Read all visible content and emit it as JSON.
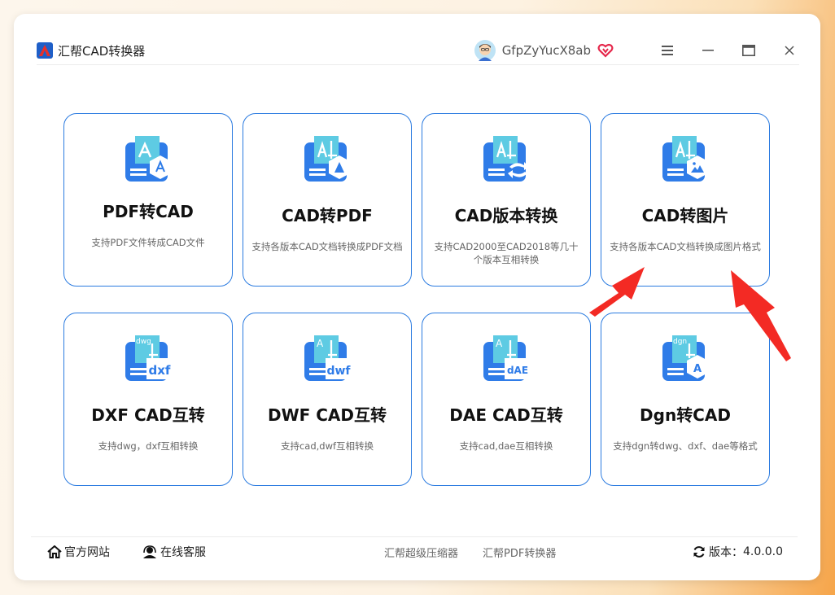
{
  "app": {
    "title": "汇帮CAD转换器"
  },
  "user": {
    "name": "GfpZyYucX8ab"
  },
  "icons": {
    "logo": "app-logo-icon",
    "avatar": "user-avatar-icon",
    "vip": "vip-heart-icon",
    "menu": "menu-icon",
    "minimize": "minimize-icon",
    "maximize": "maximize-icon",
    "close": "close-icon",
    "home": "home-icon",
    "support": "headset-icon",
    "refresh": "refresh-icon"
  },
  "colors": {
    "accent": "#2b7be0",
    "icon_blue": "#2f7ce8",
    "icon_light": "#5ecbe3",
    "arrow": "#f32a24"
  },
  "cards": [
    {
      "title": "PDF转CAD",
      "desc": "支持PDF文件转成CAD文件"
    },
    {
      "title": "CAD转PDF",
      "desc": "支持各版本CAD文档转换成PDF文档"
    },
    {
      "title": "CAD版本转换",
      "desc": "支持CAD2000至CAD2018等几十个版本互相转换"
    },
    {
      "title": "CAD转图片",
      "desc": "支持各版本CAD文档转换成图片格式"
    },
    {
      "title": "DXF CAD互转",
      "desc": "支持dwg，dxf互相转换",
      "badge": "dxf",
      "tag": "dwg"
    },
    {
      "title": "DWF CAD互转",
      "desc": "支持cad,dwf互相转换",
      "badge": "dwf",
      "tag": "A"
    },
    {
      "title": "DAE CAD互转",
      "desc": "支持cad,dae互相转换",
      "badge": "dAE",
      "tag": "A"
    },
    {
      "title": "Dgn转CAD",
      "desc": "支持dgn转dwg、dxf、dae等格式",
      "badge": "A",
      "tag": "dgn"
    }
  ],
  "footer": {
    "website": "官方网站",
    "support": "在线客服",
    "link1": "汇帮超级压缩器",
    "link2": "汇帮PDF转换器",
    "version_label": "版本：",
    "version": "4.0.0.0"
  }
}
